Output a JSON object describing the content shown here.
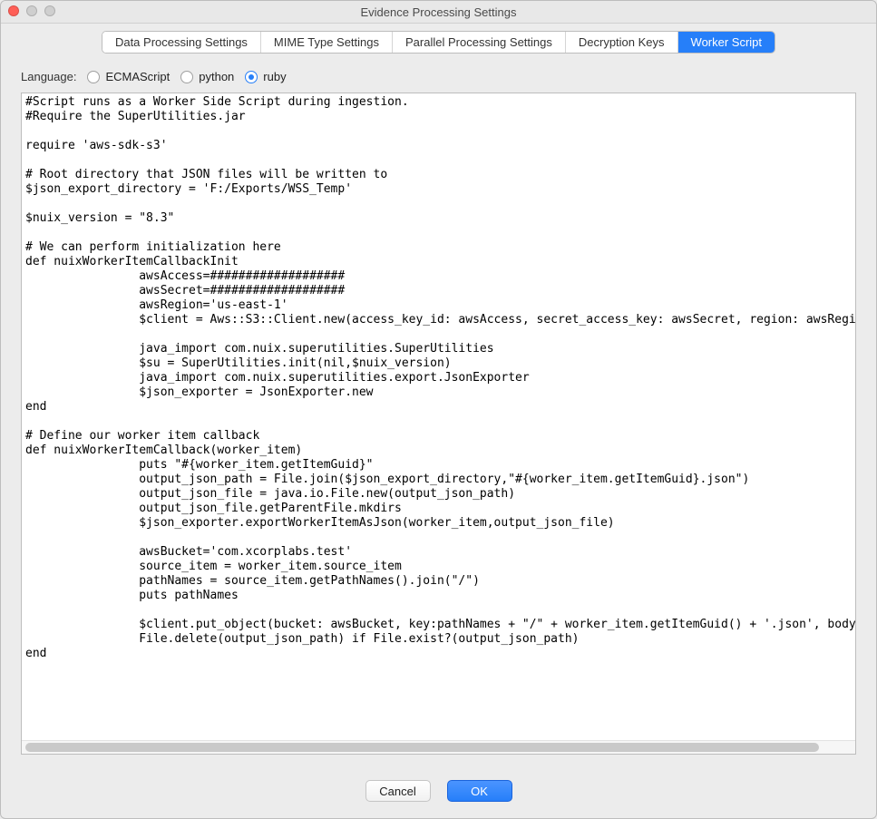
{
  "window": {
    "title": "Evidence Processing Settings"
  },
  "tabs": {
    "items": [
      {
        "label": "Data Processing Settings",
        "selected": false
      },
      {
        "label": "MIME Type Settings",
        "selected": false
      },
      {
        "label": "Parallel Processing Settings",
        "selected": false
      },
      {
        "label": "Decryption Keys",
        "selected": false
      },
      {
        "label": "Worker Script",
        "selected": true
      }
    ]
  },
  "language": {
    "label": "Language:",
    "options": [
      {
        "label": "ECMAScript",
        "selected": false
      },
      {
        "label": "python",
        "selected": false
      },
      {
        "label": "ruby",
        "selected": true
      }
    ]
  },
  "script": {
    "content": "#Script runs as a Worker Side Script during ingestion.\n#Require the SuperUtilities.jar\n\nrequire 'aws-sdk-s3'\n\n# Root directory that JSON files will be written to\n$json_export_directory = 'F:/Exports/WSS_Temp'\n\n$nuix_version = \"8.3\"\n\n# We can perform initialization here\ndef nuixWorkerItemCallbackInit\n                awsAccess=###################\n                awsSecret=###################\n                awsRegion='us-east-1'\n                $client = Aws::S3::Client.new(access_key_id: awsAccess, secret_access_key: awsSecret, region: awsRegion)\n\n                java_import com.nuix.superutilities.SuperUtilities\n                $su = SuperUtilities.init(nil,$nuix_version)\n                java_import com.nuix.superutilities.export.JsonExporter\n                $json_exporter = JsonExporter.new\nend\n\n# Define our worker item callback\ndef nuixWorkerItemCallback(worker_item)\n                puts \"#{worker_item.getItemGuid}\"\n                output_json_path = File.join($json_export_directory,\"#{worker_item.getItemGuid}.json\")\n                output_json_file = java.io.File.new(output_json_path)\n                output_json_file.getParentFile.mkdirs\n                $json_exporter.exportWorkerItemAsJson(worker_item,output_json_file)\n\n                awsBucket='com.xcorplabs.test'\n                source_item = worker_item.source_item\n                pathNames = source_item.getPathNames().join(\"/\")\n                puts pathNames\n\n                $client.put_object(bucket: awsBucket, key:pathNames + \"/\" + worker_item.getItemGuid() + '.json', body: File.read(output_json_path))\n                File.delete(output_json_path) if File.exist?(output_json_path)\nend"
  },
  "footer": {
    "cancel": "Cancel",
    "ok": "OK"
  },
  "colors": {
    "accent": "#267ff9"
  }
}
